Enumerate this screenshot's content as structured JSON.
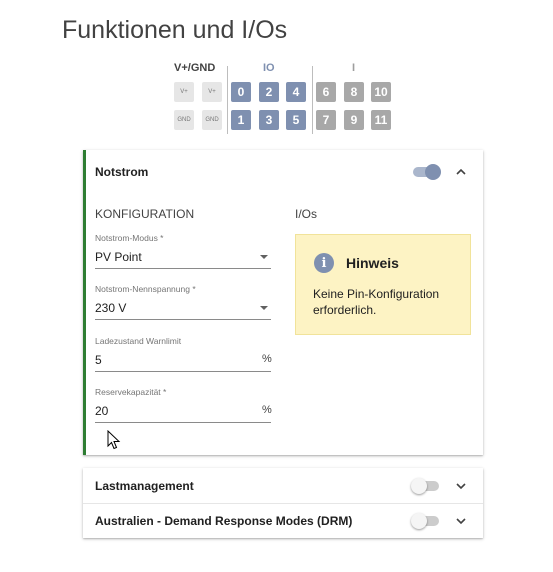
{
  "page": {
    "title": "Funktionen und I/Os"
  },
  "pins": {
    "groups": {
      "power": "V+/GND",
      "io": "IO",
      "input": "I"
    },
    "power_top": [
      "V+",
      "V+"
    ],
    "power_bottom": [
      "GND",
      "GND"
    ],
    "io_top": [
      "0",
      "2",
      "4"
    ],
    "io_bottom": [
      "1",
      "3",
      "5"
    ],
    "in_top": [
      "6",
      "8",
      "10"
    ],
    "in_bottom": [
      "7",
      "9",
      "11"
    ],
    "colors": {
      "io": "#7f90b0",
      "input": "#a8a8a8",
      "power": "#e6e6e6"
    }
  },
  "notstrom": {
    "title": "Notstrom",
    "enabled": true,
    "expanded": true,
    "accent": "#2e7d32",
    "config_heading": "KONFIGURATION",
    "ios_heading": "I/Os",
    "fields": {
      "mode": {
        "label": "Notstrom-Modus *",
        "value": "PV Point"
      },
      "voltage": {
        "label": "Notstrom-Nennspannung *",
        "value": "230 V"
      },
      "warn": {
        "label": "Ladezustand Warnlimit",
        "value": "5",
        "unit": "%"
      },
      "reserve": {
        "label": "Reservekapazität *",
        "value": "20",
        "unit": "%"
      }
    },
    "hint": {
      "icon": "info-icon",
      "title": "Hinweis",
      "text": "Keine Pin-Konfiguration erforderlich."
    }
  },
  "lastmanagement": {
    "title": "Lastmanagement",
    "enabled": false,
    "expanded": false
  },
  "drm": {
    "title": "Australien - Demand Response Modes (DRM)",
    "enabled": false,
    "expanded": false
  }
}
